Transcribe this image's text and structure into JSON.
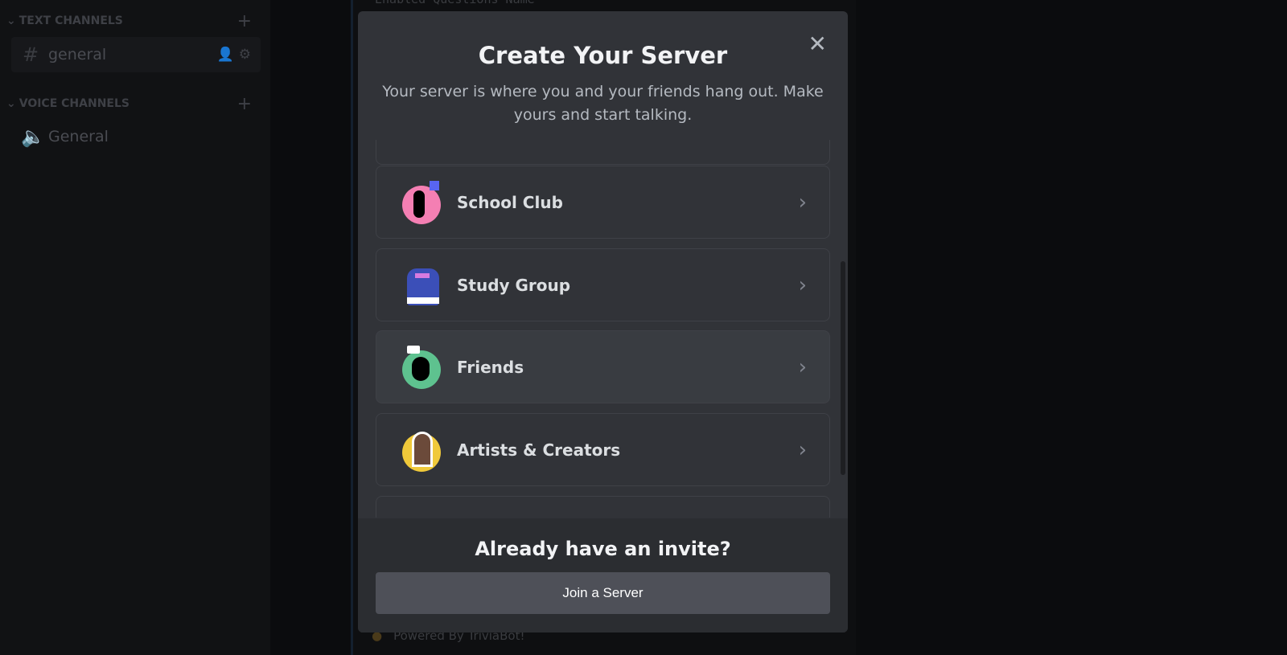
{
  "sidebar": {
    "text_category": "TEXT CHANNELS",
    "voice_category": "VOICE CHANNELS",
    "text_channels": [
      {
        "name": "general"
      }
    ],
    "voice_channels": [
      {
        "name": "General"
      }
    ]
  },
  "background": {
    "header_text": "Enabled Questions  Name",
    "footer_text": "Powered By TriviaBot!"
  },
  "modal": {
    "title": "Create Your Server",
    "subtitle": "Your server is where you and your friends hang out. Make yours and start talking.",
    "templates": [
      {
        "label": "School Club",
        "icon": "school-club-illustration",
        "color": "#f47fb3"
      },
      {
        "label": "Study Group",
        "icon": "backpack-illustration",
        "color": "#3b4fb8"
      },
      {
        "label": "Friends",
        "icon": "friends-illustration",
        "color": "#5ec28f"
      },
      {
        "label": "Artists & Creators",
        "icon": "artists-illustration",
        "color": "#f0c93a"
      }
    ],
    "footer_title": "Already have an invite?",
    "join_button": "Join a Server"
  }
}
